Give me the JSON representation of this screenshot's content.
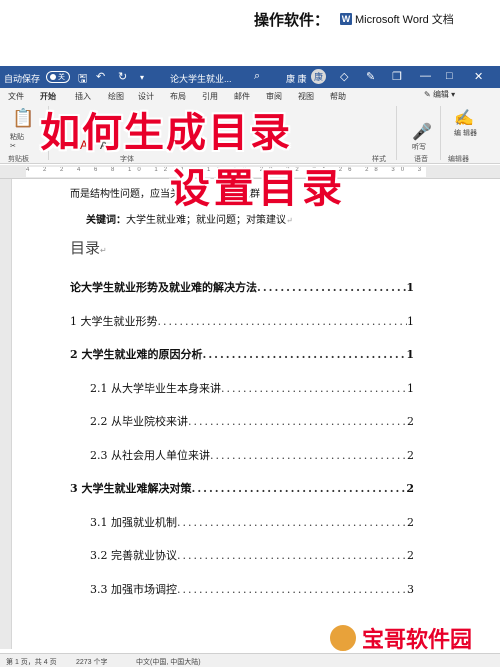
{
  "caption": {
    "label": "操作软件：",
    "app_name": "Microsoft Word 文档",
    "word_icon": "W"
  },
  "titlebar": {
    "autosave": "自动保存",
    "toggle_state": "关",
    "doc_title": "论大学生就业...",
    "user": "康 康",
    "avatar_initial": "康"
  },
  "tabs": [
    "文件",
    "开始",
    "插入",
    "绘图",
    "设计",
    "布局",
    "引用",
    "邮件",
    "审阅",
    "视图",
    "帮助"
  ],
  "tabs_right": {
    "edit_label": "编辑"
  },
  "ribbon": {
    "paste": "粘贴",
    "clipboard": "剪贴板",
    "font": "字体",
    "styles": "样式",
    "voice": "语音",
    "dictate": "听写",
    "editor": "编辑器",
    "editor_label": "编\n辑器"
  },
  "overlay": {
    "line1": "如何生成目录",
    "line2": "设置目录"
  },
  "ruler_text": "4 2 2 4 6 8 10 12 14 16 18 20 22 24 26 28 30 32 34 36 38",
  "document": {
    "intro": "而是结构性问题，应当关",
    "intro_tail": "业群",
    "keywords_label": "关键词：",
    "keywords": "大学生就业难；就业问题；对策建议",
    "toc_heading": "目录",
    "toc": [
      {
        "text": "论大学生就业形势及就业难的解决方法",
        "page": "1",
        "bold": true,
        "indent": 0
      },
      {
        "text": "1  大学生就业形势",
        "page": "1",
        "bold": false,
        "indent": 0
      },
      {
        "text": "2  大学生就业难的原因分析",
        "page": "1",
        "bold": true,
        "indent": 0
      },
      {
        "text": "2.1  从大学毕业生本身来讲",
        "page": "1",
        "bold": false,
        "indent": 1
      },
      {
        "text": "2.2  从毕业院校来讲",
        "page": "2",
        "bold": false,
        "indent": 1
      },
      {
        "text": "2.3  从社会用人单位来讲",
        "page": "2",
        "bold": false,
        "indent": 1
      },
      {
        "text": "3  大学生就业难解决对策",
        "page": "2",
        "bold": true,
        "indent": 0
      },
      {
        "text": "3.1  加强就业机制",
        "page": "2",
        "bold": false,
        "indent": 1
      },
      {
        "text": "3.2  完善就业协议",
        "page": "2",
        "bold": false,
        "indent": 1
      },
      {
        "text": "3.3  加强市场调控",
        "page": "3",
        "bold": false,
        "indent": 1
      }
    ]
  },
  "statusbar": {
    "page": "第 1 页，共 4 页",
    "words": "2273 个字",
    "lang": "中文(中国, 中国大陆)"
  },
  "watermark": {
    "text": "宝哥软件园"
  },
  "colors": {
    "word_blue": "#2b579a",
    "title_red": "#e8002a"
  }
}
